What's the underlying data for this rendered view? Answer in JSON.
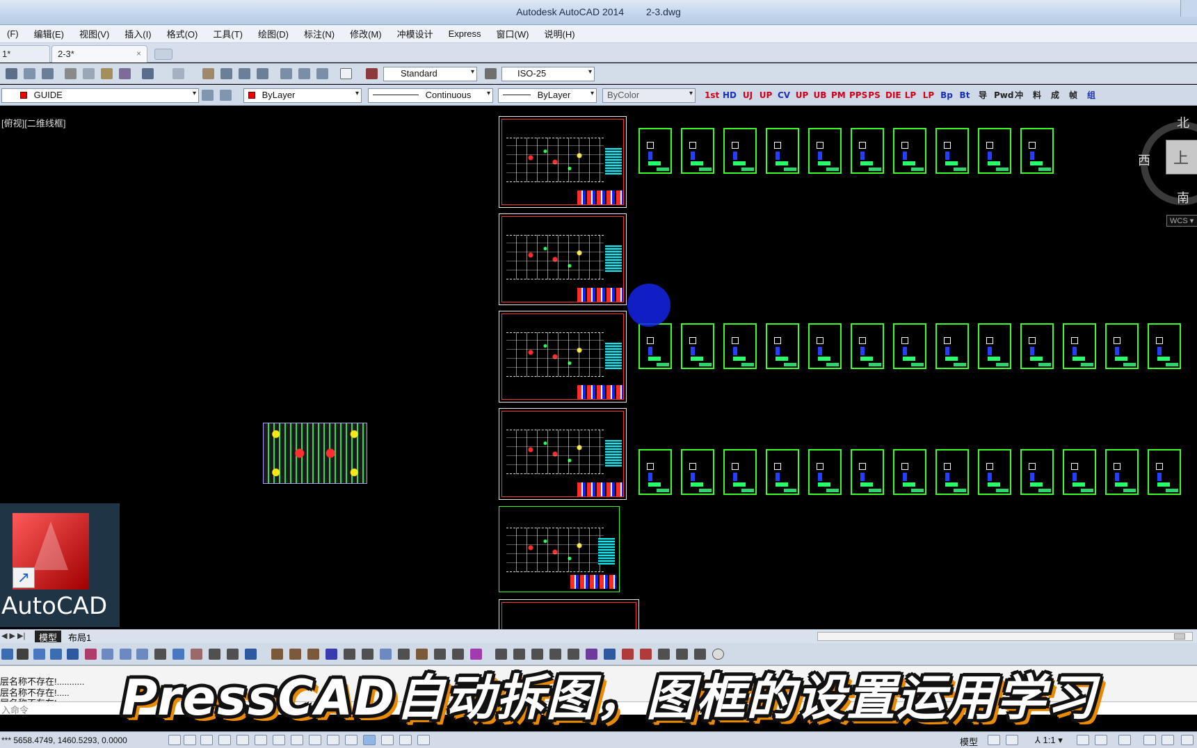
{
  "window": {
    "app_title": "Autodesk AutoCAD 2014",
    "doc_title": "2-3.dwg"
  },
  "menu": [
    "(F)",
    "编辑(E)",
    "视图(V)",
    "插入(I)",
    "格式(O)",
    "工具(T)",
    "绘图(D)",
    "标注(N)",
    "修改(M)",
    "冲模设计",
    "Express",
    "窗口(W)",
    "说明(H)"
  ],
  "tabs": {
    "tab1": "1*",
    "tab2": "2-3*",
    "close": "×"
  },
  "toolbar": {
    "text_style": "Standard",
    "dim_style": "ISO-25",
    "layer": "GUIDE",
    "color": "ByLayer",
    "linetype": "Continuous",
    "lineweight": "ByLayer",
    "plot_style": "ByColor",
    "arrow": "▾"
  },
  "pp_toolbar": [
    "1st",
    "HD",
    "UJ",
    "UP",
    "CV",
    "UP",
    "UB",
    "PM",
    "PPS",
    "PS",
    "DIE",
    "LP",
    "LP",
    "Bp",
    "Bt",
    "导",
    "Pwd",
    "冲",
    "料",
    "成",
    "帧",
    "组"
  ],
  "canvas": {
    "view_label": "[俯视][二维线框]",
    "compass": {
      "north": "北",
      "south": "南",
      "west": "西",
      "top": "上"
    },
    "wcs": "WCS ▾"
  },
  "desktop_icon": {
    "label": "AutoCAD",
    "shortcut_arrow": "↗"
  },
  "layout_tabs": {
    "model": "模型",
    "layout1": "布局1",
    "nav": "◀ ▶ ▶|"
  },
  "command": {
    "history": [
      "层名称不存在!...........",
      "层名称不存在!.....",
      "层名称不存在!"
    ],
    "prompt": "入命令"
  },
  "status": {
    "coords": "***   5658.4749,  1460.5293,  0.0000",
    "model": "模型",
    "scale": "⅄ 1:1 ▾"
  },
  "caption": "PressCAD自动拆图，图框的设置运用学习",
  "colors": {
    "canvas_bg": "#000000",
    "frame_green": "#3cff28",
    "cursor_blue": "#1423e6",
    "caption_outline": "#e98a00"
  }
}
